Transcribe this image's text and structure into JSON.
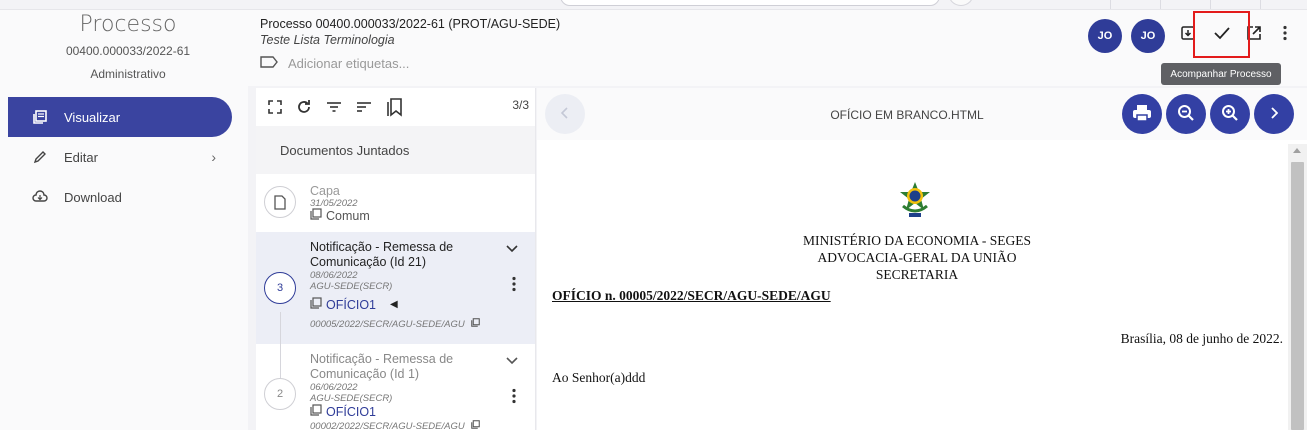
{
  "sidebar": {
    "title": "Processo",
    "number": "00400.000033/2022-61",
    "type": "Administrativo",
    "items": [
      {
        "label": "Visualizar",
        "icon": "view-icon",
        "active": true
      },
      {
        "label": "Editar",
        "icon": "pencil-icon",
        "active": false
      },
      {
        "label": "Download",
        "icon": "cloud-download-icon",
        "active": false
      }
    ]
  },
  "header": {
    "title": "Processo 00400.000033/2022-61 (PROT/AGU-SEDE)",
    "subtitle": "Teste Lista Terminologia",
    "tags_placeholder": "Adicionar etiquetas...",
    "avatars": [
      "JO",
      "JO"
    ],
    "tooltip": "Acompanhar Processo",
    "accent": "#2f3c98",
    "highlight_color": "#e31b1b"
  },
  "documents": {
    "count": "3/3",
    "heading": "Documentos Juntados",
    "items": [
      {
        "title": "Capa",
        "date": "31/05/2022",
        "link": "Comum"
      },
      {
        "title": "Notificação - Remessa de Comunicação (Id 21)",
        "date": "08/06/2022",
        "unit": "AGU-SEDE(SECR)",
        "number": "3",
        "link": "OFÍCIO1",
        "ref": "00005/2022/SECR/AGU-SEDE/AGU"
      },
      {
        "title": "Notificação - Remessa de Comunicação (Id 1)",
        "date": "06/06/2022",
        "unit": "AGU-SEDE(SECR)",
        "number": "2",
        "link": "OFÍCIO1",
        "ref": "00002/2022/SECR/AGU-SEDE/AGU"
      }
    ]
  },
  "viewer": {
    "title": "OFÍCIO EM BRANCO.HTML",
    "org_lines": [
      "MINISTÉRIO DA ECONOMIA - SEGES",
      "ADVOCACIA-GERAL DA UNIÃO",
      "SECRETARIA"
    ],
    "oficio": "OFÍCIO n. 00005/2022/SECR/AGU-SEDE/AGU",
    "place_date": "Brasília, 08 de junho de 2022.",
    "addressee": "Ao Senhor(a)ddd"
  }
}
